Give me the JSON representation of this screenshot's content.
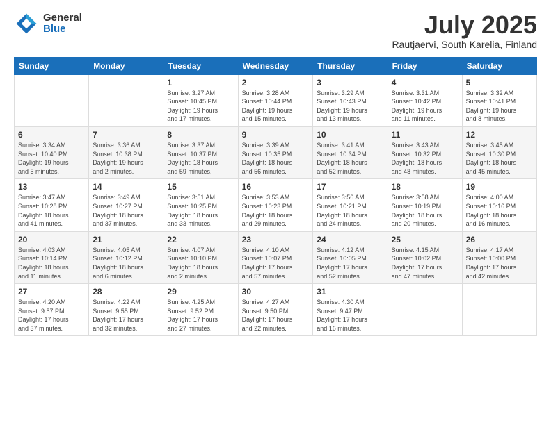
{
  "header": {
    "logo_general": "General",
    "logo_blue": "Blue",
    "title": "July 2025",
    "location": "Rautjaervi, South Karelia, Finland"
  },
  "days_of_week": [
    "Sunday",
    "Monday",
    "Tuesday",
    "Wednesday",
    "Thursday",
    "Friday",
    "Saturday"
  ],
  "weeks": [
    [
      {
        "day": "",
        "detail": ""
      },
      {
        "day": "",
        "detail": ""
      },
      {
        "day": "1",
        "detail": "Sunrise: 3:27 AM\nSunset: 10:45 PM\nDaylight: 19 hours\nand 17 minutes."
      },
      {
        "day": "2",
        "detail": "Sunrise: 3:28 AM\nSunset: 10:44 PM\nDaylight: 19 hours\nand 15 minutes."
      },
      {
        "day": "3",
        "detail": "Sunrise: 3:29 AM\nSunset: 10:43 PM\nDaylight: 19 hours\nand 13 minutes."
      },
      {
        "day": "4",
        "detail": "Sunrise: 3:31 AM\nSunset: 10:42 PM\nDaylight: 19 hours\nand 11 minutes."
      },
      {
        "day": "5",
        "detail": "Sunrise: 3:32 AM\nSunset: 10:41 PM\nDaylight: 19 hours\nand 8 minutes."
      }
    ],
    [
      {
        "day": "6",
        "detail": "Sunrise: 3:34 AM\nSunset: 10:40 PM\nDaylight: 19 hours\nand 5 minutes."
      },
      {
        "day": "7",
        "detail": "Sunrise: 3:36 AM\nSunset: 10:38 PM\nDaylight: 19 hours\nand 2 minutes."
      },
      {
        "day": "8",
        "detail": "Sunrise: 3:37 AM\nSunset: 10:37 PM\nDaylight: 18 hours\nand 59 minutes."
      },
      {
        "day": "9",
        "detail": "Sunrise: 3:39 AM\nSunset: 10:35 PM\nDaylight: 18 hours\nand 56 minutes."
      },
      {
        "day": "10",
        "detail": "Sunrise: 3:41 AM\nSunset: 10:34 PM\nDaylight: 18 hours\nand 52 minutes."
      },
      {
        "day": "11",
        "detail": "Sunrise: 3:43 AM\nSunset: 10:32 PM\nDaylight: 18 hours\nand 48 minutes."
      },
      {
        "day": "12",
        "detail": "Sunrise: 3:45 AM\nSunset: 10:30 PM\nDaylight: 18 hours\nand 45 minutes."
      }
    ],
    [
      {
        "day": "13",
        "detail": "Sunrise: 3:47 AM\nSunset: 10:28 PM\nDaylight: 18 hours\nand 41 minutes."
      },
      {
        "day": "14",
        "detail": "Sunrise: 3:49 AM\nSunset: 10:27 PM\nDaylight: 18 hours\nand 37 minutes."
      },
      {
        "day": "15",
        "detail": "Sunrise: 3:51 AM\nSunset: 10:25 PM\nDaylight: 18 hours\nand 33 minutes."
      },
      {
        "day": "16",
        "detail": "Sunrise: 3:53 AM\nSunset: 10:23 PM\nDaylight: 18 hours\nand 29 minutes."
      },
      {
        "day": "17",
        "detail": "Sunrise: 3:56 AM\nSunset: 10:21 PM\nDaylight: 18 hours\nand 24 minutes."
      },
      {
        "day": "18",
        "detail": "Sunrise: 3:58 AM\nSunset: 10:19 PM\nDaylight: 18 hours\nand 20 minutes."
      },
      {
        "day": "19",
        "detail": "Sunrise: 4:00 AM\nSunset: 10:16 PM\nDaylight: 18 hours\nand 16 minutes."
      }
    ],
    [
      {
        "day": "20",
        "detail": "Sunrise: 4:03 AM\nSunset: 10:14 PM\nDaylight: 18 hours\nand 11 minutes."
      },
      {
        "day": "21",
        "detail": "Sunrise: 4:05 AM\nSunset: 10:12 PM\nDaylight: 18 hours\nand 6 minutes."
      },
      {
        "day": "22",
        "detail": "Sunrise: 4:07 AM\nSunset: 10:10 PM\nDaylight: 18 hours\nand 2 minutes."
      },
      {
        "day": "23",
        "detail": "Sunrise: 4:10 AM\nSunset: 10:07 PM\nDaylight: 17 hours\nand 57 minutes."
      },
      {
        "day": "24",
        "detail": "Sunrise: 4:12 AM\nSunset: 10:05 PM\nDaylight: 17 hours\nand 52 minutes."
      },
      {
        "day": "25",
        "detail": "Sunrise: 4:15 AM\nSunset: 10:02 PM\nDaylight: 17 hours\nand 47 minutes."
      },
      {
        "day": "26",
        "detail": "Sunrise: 4:17 AM\nSunset: 10:00 PM\nDaylight: 17 hours\nand 42 minutes."
      }
    ],
    [
      {
        "day": "27",
        "detail": "Sunrise: 4:20 AM\nSunset: 9:57 PM\nDaylight: 17 hours\nand 37 minutes."
      },
      {
        "day": "28",
        "detail": "Sunrise: 4:22 AM\nSunset: 9:55 PM\nDaylight: 17 hours\nand 32 minutes."
      },
      {
        "day": "29",
        "detail": "Sunrise: 4:25 AM\nSunset: 9:52 PM\nDaylight: 17 hours\nand 27 minutes."
      },
      {
        "day": "30",
        "detail": "Sunrise: 4:27 AM\nSunset: 9:50 PM\nDaylight: 17 hours\nand 22 minutes."
      },
      {
        "day": "31",
        "detail": "Sunrise: 4:30 AM\nSunset: 9:47 PM\nDaylight: 17 hours\nand 16 minutes."
      },
      {
        "day": "",
        "detail": ""
      },
      {
        "day": "",
        "detail": ""
      }
    ]
  ]
}
